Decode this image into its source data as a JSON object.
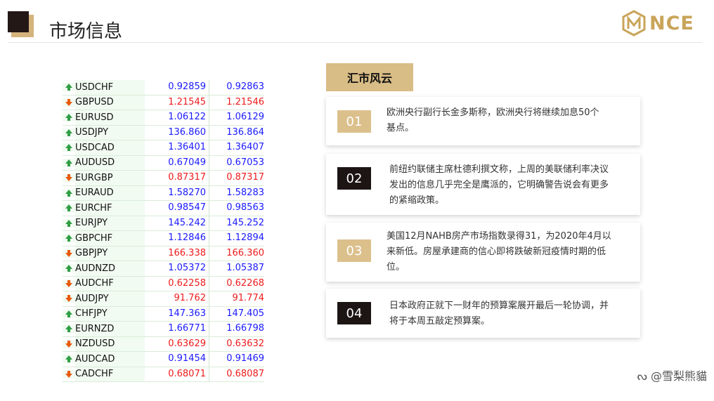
{
  "header": {
    "title": "市场信息",
    "logo_text": "NCE",
    "logo_color": "#c9a45a"
  },
  "fx_table": {
    "colors": {
      "up": "#1a1aff",
      "down": "#ee1b1b"
    },
    "rows": [
      {
        "symbol": "USDCHF",
        "bid": "0.92859",
        "ask": "0.92863",
        "dir": "up"
      },
      {
        "symbol": "GBPUSD",
        "bid": "1.21545",
        "ask": "1.21546",
        "dir": "down"
      },
      {
        "symbol": "EURUSD",
        "bid": "1.06122",
        "ask": "1.06129",
        "dir": "up"
      },
      {
        "symbol": "USDJPY",
        "bid": "136.860",
        "ask": "136.864",
        "dir": "up"
      },
      {
        "symbol": "USDCAD",
        "bid": "1.36401",
        "ask": "1.36407",
        "dir": "up"
      },
      {
        "symbol": "AUDUSD",
        "bid": "0.67049",
        "ask": "0.67053",
        "dir": "up"
      },
      {
        "symbol": "EURGBP",
        "bid": "0.87317",
        "ask": "0.87317",
        "dir": "down"
      },
      {
        "symbol": "EURAUD",
        "bid": "1.58270",
        "ask": "1.58283",
        "dir": "up"
      },
      {
        "symbol": "EURCHF",
        "bid": "0.98547",
        "ask": "0.98563",
        "dir": "up"
      },
      {
        "symbol": "EURJPY",
        "bid": "145.242",
        "ask": "145.252",
        "dir": "up"
      },
      {
        "symbol": "GBPCHF",
        "bid": "1.12846",
        "ask": "1.12894",
        "dir": "up"
      },
      {
        "symbol": "GBPJPY",
        "bid": "166.338",
        "ask": "166.360",
        "dir": "down"
      },
      {
        "symbol": "AUDNZD",
        "bid": "1.05372",
        "ask": "1.05387",
        "dir": "up"
      },
      {
        "symbol": "AUDCHF",
        "bid": "0.62258",
        "ask": "0.62268",
        "dir": "down"
      },
      {
        "symbol": "AUDJPY",
        "bid": "91.762",
        "ask": "91.774",
        "dir": "down"
      },
      {
        "symbol": "CHFJPY",
        "bid": "147.363",
        "ask": "147.405",
        "dir": "up"
      },
      {
        "symbol": "EURNZD",
        "bid": "1.66771",
        "ask": "1.66798",
        "dir": "up"
      },
      {
        "symbol": "NZDUSD",
        "bid": "0.63629",
        "ask": "0.63632",
        "dir": "down"
      },
      {
        "symbol": "AUDCAD",
        "bid": "0.91454",
        "ask": "0.91469",
        "dir": "up"
      },
      {
        "symbol": "CADCHF",
        "bid": "0.68071",
        "ask": "0.68087",
        "dir": "down"
      }
    ]
  },
  "news": {
    "header": "汇市风云",
    "items": [
      {
        "num": "01",
        "style": "gold",
        "lines": [
          "欧洲央行副行长金多斯称，欧洲央行将继续加息50个",
          "基点。"
        ]
      },
      {
        "num": "02",
        "style": "dark",
        "lines": [
          "前纽约联储主席杜德利撰文称，上周的美联储利率决议",
          "发出的信息几乎完全是鹰派的，它明确警告说会有更多",
          "的紧缩政策。"
        ]
      },
      {
        "num": "03",
        "style": "gold",
        "lines": [
          "美国12月NAHB房产市场指数录得31，为2020年4月以",
          "来新低。房屋承建商的信心即将跌破新冠疫情时期的低",
          "位。"
        ]
      },
      {
        "num": "04",
        "style": "dark",
        "lines": [
          "日本政府正就下一财年的预算案展开最后一轮协调，并",
          "将于本周五敲定预算案。"
        ]
      }
    ]
  },
  "watermark": "@雪梨熊貓"
}
